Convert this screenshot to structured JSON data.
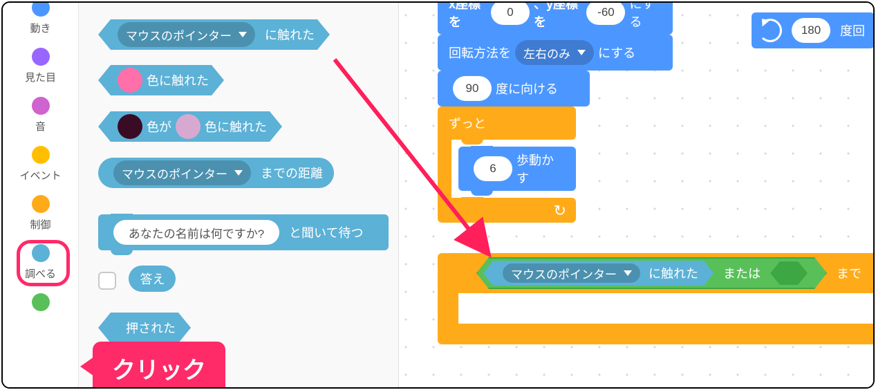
{
  "categories": [
    {
      "label": "動き",
      "color": "#4c97ff"
    },
    {
      "label": "見た目",
      "color": "#9966ff"
    },
    {
      "label": "音",
      "color": "#cf63cf"
    },
    {
      "label": "イベント",
      "color": "#ffbf00"
    },
    {
      "label": "制御",
      "color": "#ffab19"
    },
    {
      "label": "調べる",
      "color": "#5cb1d6"
    },
    {
      "label": "",
      "color": "#59c059"
    }
  ],
  "palette": {
    "touching": {
      "menu": "マウスのポインター",
      "suffix": "に触れた"
    },
    "touching_color": {
      "suffix": "色に触れた",
      "color": "#ff6fa9"
    },
    "color_touching": {
      "mid": "色が",
      "suffix": "色に触れた",
      "c1": "#3a0b24",
      "c2": "#d7a9d0"
    },
    "distance": {
      "menu": "マウスのポインター",
      "suffix": "までの距離"
    },
    "ask": {
      "question": "あなたの名前は何ですか?",
      "suffix": "と聞いて待つ"
    },
    "answer": {
      "label": "答え"
    },
    "key_pressed": {
      "suffix": "押された"
    }
  },
  "script": {
    "goto": {
      "prefix_partial": "x座標を",
      "x": "0",
      "mid": "、y座標を",
      "y": "-60",
      "suffix": "にする"
    },
    "rot_style": {
      "prefix": "回転方法を",
      "menu": "左右のみ",
      "suffix": "にする"
    },
    "point": {
      "value": "90",
      "suffix": "度に向ける"
    },
    "forever": {
      "label": "ずっと"
    },
    "move": {
      "value": "6",
      "suffix": "歩動かす"
    },
    "turn": {
      "value": "180",
      "suffix": "度回"
    },
    "target_hex": {
      "menu": "マウスのポインター",
      "suffix": "に触れた",
      "or": "または",
      "tail": "まで"
    }
  },
  "annotation": {
    "click": "クリック"
  }
}
